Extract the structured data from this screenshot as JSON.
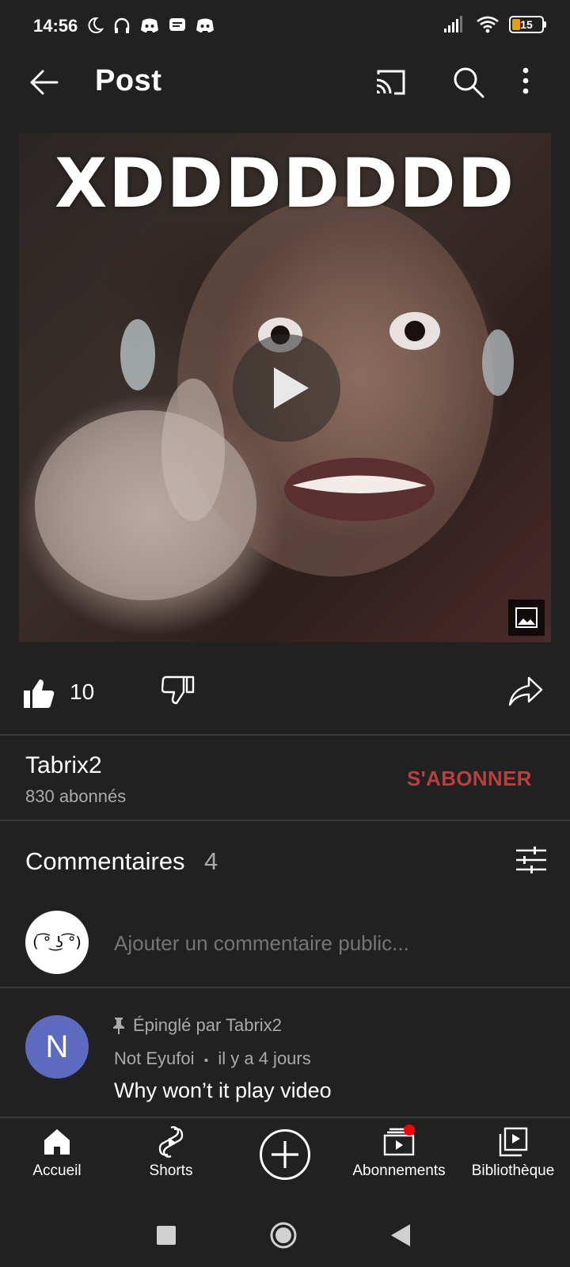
{
  "status_bar": {
    "time": "14:56",
    "battery": "15",
    "battery_color": "#e8a100"
  },
  "app_bar": {
    "title": "Post",
    "icons": [
      "back-arrow-icon",
      "cast-icon",
      "search-icon",
      "more-vert-icon"
    ]
  },
  "media": {
    "caption": "XDDDDDDD",
    "icons": [
      "play-icon",
      "image-icon"
    ]
  },
  "actions": {
    "like_count": "10",
    "icons": [
      "thumb-up-icon",
      "thumb-down-icon",
      "share-icon"
    ]
  },
  "channel": {
    "name": "Tabrix2",
    "subscribers": "830 abonnés",
    "subscribe_label": "S'ABONNER",
    "subscribe_color": "#b8403e"
  },
  "comments": {
    "title": "Commentaires",
    "count": "4",
    "self_avatar": "( ͡° ͜ʖ ͡°)",
    "placeholder": "Ajouter un commentaire public...",
    "pinned": {
      "pinned_label": "Épinglé par Tabrix2",
      "avatar_letter": "N",
      "avatar_color": "#5c6bc0",
      "author": "Not Eyufoi",
      "separator": "•",
      "time": "il y a 4 jours",
      "text": "Why won’t it play video"
    }
  },
  "bottom_nav": {
    "items": [
      {
        "label": "Accueil",
        "icon": "home-icon"
      },
      {
        "label": "Shorts",
        "icon": "shorts-icon"
      },
      {
        "label": "",
        "icon": "create-icon"
      },
      {
        "label": "Abonnements",
        "icon": "subscriptions-icon"
      },
      {
        "label": "Bibliothèque",
        "icon": "library-icon"
      }
    ]
  },
  "system_nav": {
    "icons": [
      "recents-square-icon",
      "home-circle-icon",
      "back-triangle-icon"
    ]
  }
}
